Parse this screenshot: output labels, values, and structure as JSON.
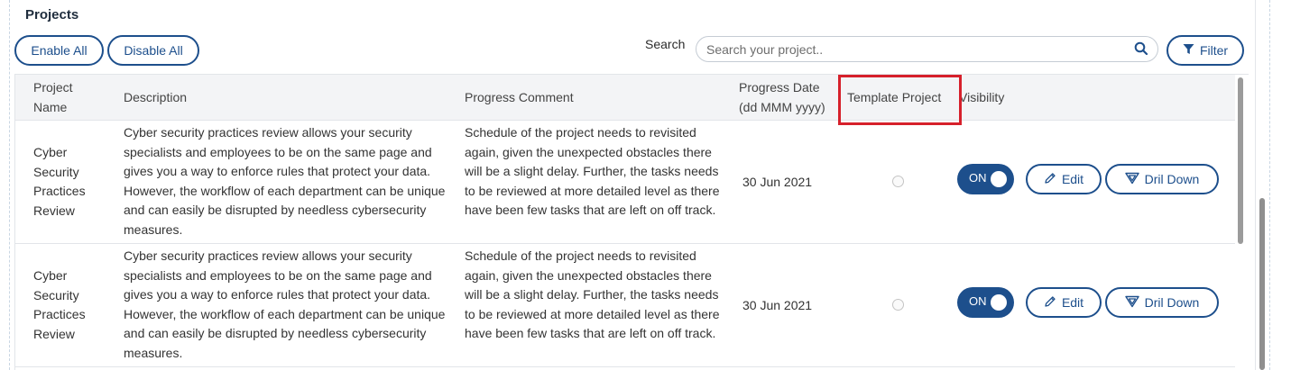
{
  "section": {
    "title": "Projects"
  },
  "toolbar": {
    "enable_all_label": "Enable All",
    "disable_all_label": "Disable All",
    "search_label": "Search",
    "search_placeholder": "Search your project..",
    "search_value": "",
    "filter_label": "Filter"
  },
  "table": {
    "headers": {
      "project_name": "Project Name",
      "description": "Description",
      "progress_comment": "Progress Comment",
      "progress_date": "Progress Date (dd MMM yyyy)",
      "template_project": "Template Project",
      "visibility": "Visibility"
    },
    "rows": [
      {
        "project_name": "Cyber Security Practices Review",
        "description": "Cyber security practices review allows your security specialists and employees to be on the same page and gives you a way to enforce rules that protect your data. However, the workflow of each department can be unique and can easily be disrupted by needless cybersecurity measures.",
        "progress_comment": "Schedule of the project needs to revisited again, given the unexpected obstacles there will be a slight delay. Further, the tasks needs to be reviewed at more detailed level as there have been few tasks that are left on off track.",
        "progress_date": "30 Jun 2021",
        "template_project": false,
        "visibility_label": "ON",
        "edit_label": "Edit",
        "drill_down_label": "Dril Down"
      },
      {
        "project_name": "Cyber Security Practices Review",
        "description": "Cyber security practices review allows your security specialists and employees to be on the same page and gives you a way to enforce rules that protect your data. However, the workflow of each department can be unique and can easily be disrupted by needless cybersecurity measures.",
        "progress_comment": "Schedule of the project needs to revisited again, given the unexpected obstacles there will be a slight delay. Further, the tasks needs to be reviewed at more detailed level as there have been few tasks that are left on off track.",
        "progress_date": "30 Jun 2021",
        "template_project": false,
        "visibility_label": "ON",
        "edit_label": "Edit",
        "drill_down_label": "Dril Down"
      }
    ]
  },
  "colors": {
    "accent": "#1d4f8c",
    "highlight": "#d6202b",
    "header_bg": "#f3f4f6"
  },
  "icons": {
    "search": "search-icon",
    "filter": "filter-icon",
    "edit": "pencil-icon",
    "drill_down": "drill-down-icon"
  }
}
